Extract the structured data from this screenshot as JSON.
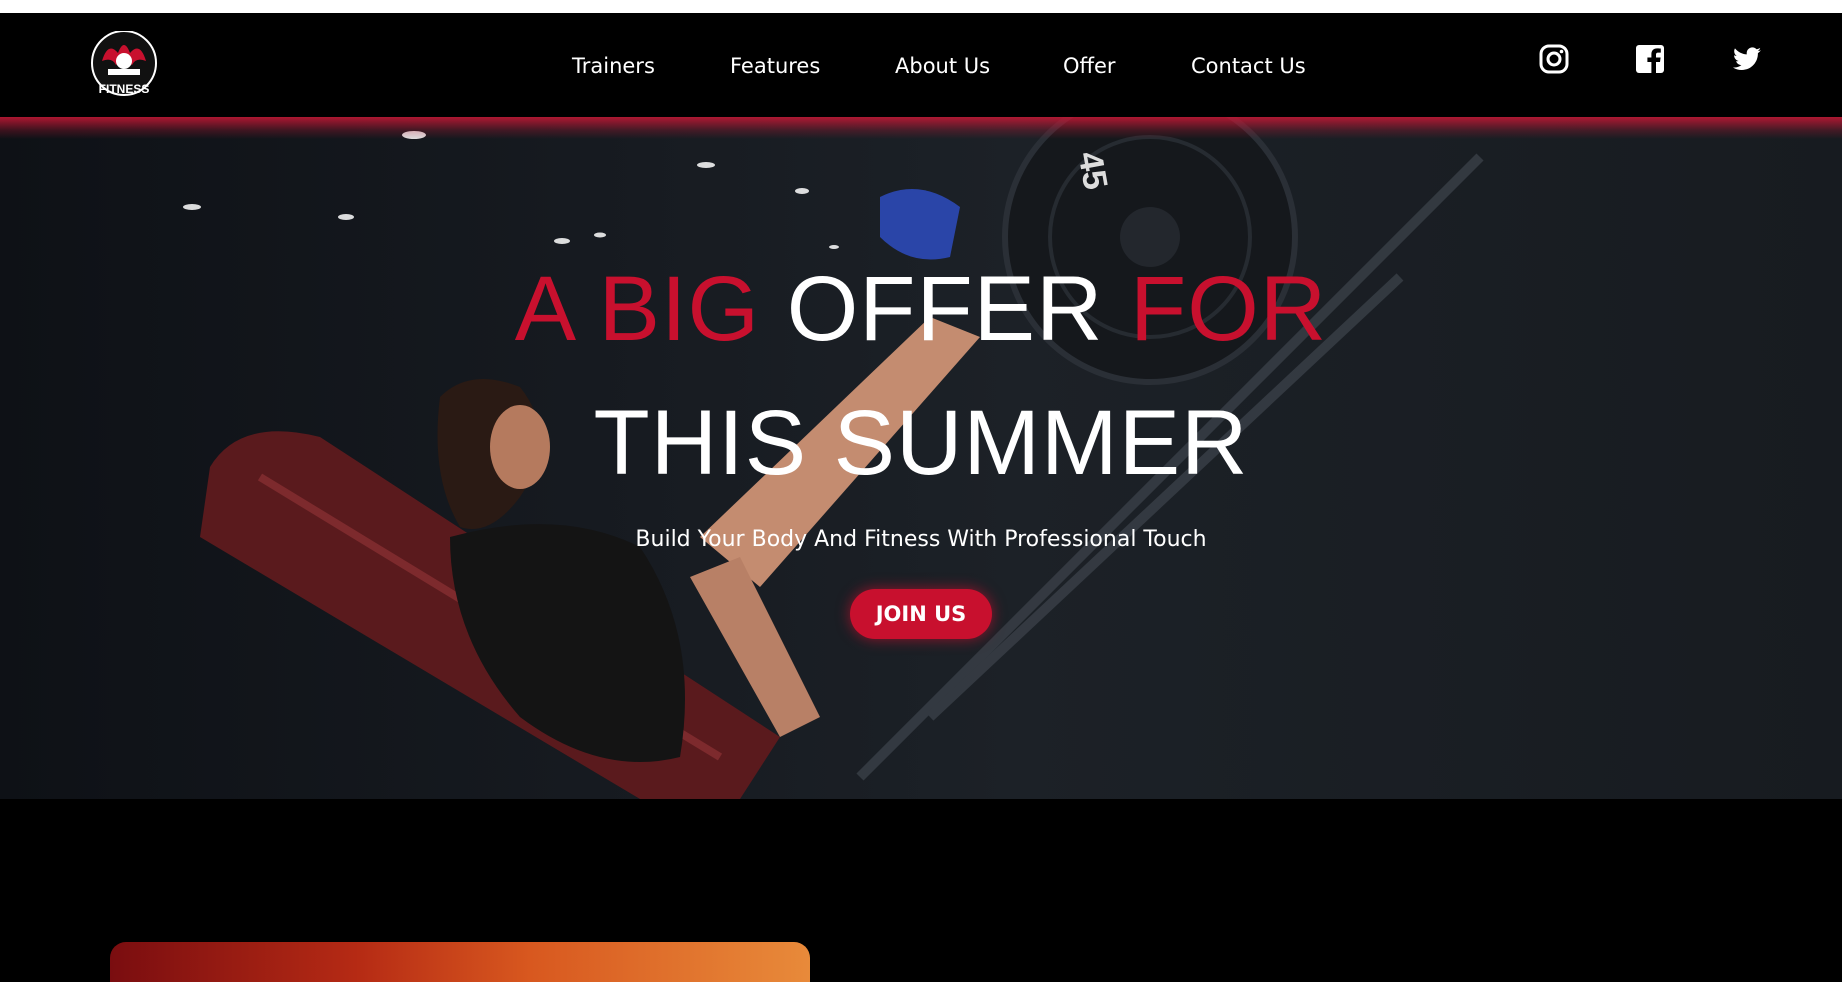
{
  "nav": {
    "logo_text": "FITNESS",
    "links": [
      "Trainers",
      "Features",
      "About Us",
      "Offer",
      "Contact Us"
    ],
    "social": [
      "instagram-icon",
      "facebook-icon",
      "twitter-icon"
    ]
  },
  "hero": {
    "headline_line1": [
      "A BIG",
      "OFFER",
      "FOR"
    ],
    "headline_line2": "THIS SUMMER",
    "subtitle": "Build Your Body And Fitness With Professional Touch",
    "cta_label": "JOIN US"
  },
  "colors": {
    "accent": "#c8102e",
    "background": "#000000",
    "text": "#ffffff"
  }
}
